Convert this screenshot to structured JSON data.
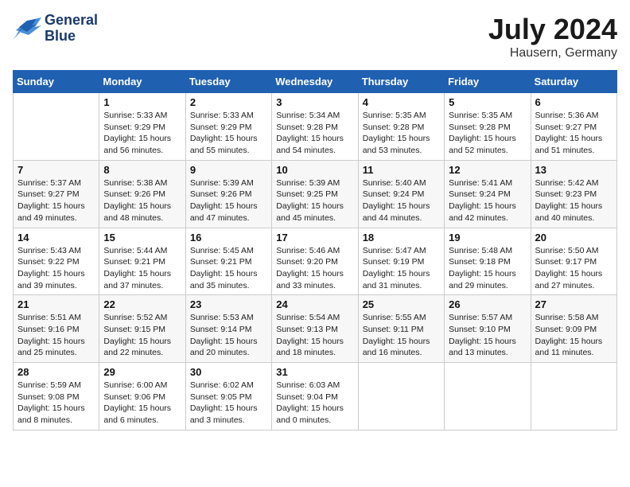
{
  "header": {
    "logo_line1": "General",
    "logo_line2": "Blue",
    "month_year": "July 2024",
    "location": "Hausern, Germany"
  },
  "weekdays": [
    "Sunday",
    "Monday",
    "Tuesday",
    "Wednesday",
    "Thursday",
    "Friday",
    "Saturday"
  ],
  "weeks": [
    [
      {
        "day": "",
        "info": ""
      },
      {
        "day": "1",
        "info": "Sunrise: 5:33 AM\nSunset: 9:29 PM\nDaylight: 15 hours\nand 56 minutes."
      },
      {
        "day": "2",
        "info": "Sunrise: 5:33 AM\nSunset: 9:29 PM\nDaylight: 15 hours\nand 55 minutes."
      },
      {
        "day": "3",
        "info": "Sunrise: 5:34 AM\nSunset: 9:28 PM\nDaylight: 15 hours\nand 54 minutes."
      },
      {
        "day": "4",
        "info": "Sunrise: 5:35 AM\nSunset: 9:28 PM\nDaylight: 15 hours\nand 53 minutes."
      },
      {
        "day": "5",
        "info": "Sunrise: 5:35 AM\nSunset: 9:28 PM\nDaylight: 15 hours\nand 52 minutes."
      },
      {
        "day": "6",
        "info": "Sunrise: 5:36 AM\nSunset: 9:27 PM\nDaylight: 15 hours\nand 51 minutes."
      }
    ],
    [
      {
        "day": "7",
        "info": "Sunrise: 5:37 AM\nSunset: 9:27 PM\nDaylight: 15 hours\nand 49 minutes."
      },
      {
        "day": "8",
        "info": "Sunrise: 5:38 AM\nSunset: 9:26 PM\nDaylight: 15 hours\nand 48 minutes."
      },
      {
        "day": "9",
        "info": "Sunrise: 5:39 AM\nSunset: 9:26 PM\nDaylight: 15 hours\nand 47 minutes."
      },
      {
        "day": "10",
        "info": "Sunrise: 5:39 AM\nSunset: 9:25 PM\nDaylight: 15 hours\nand 45 minutes."
      },
      {
        "day": "11",
        "info": "Sunrise: 5:40 AM\nSunset: 9:24 PM\nDaylight: 15 hours\nand 44 minutes."
      },
      {
        "day": "12",
        "info": "Sunrise: 5:41 AM\nSunset: 9:24 PM\nDaylight: 15 hours\nand 42 minutes."
      },
      {
        "day": "13",
        "info": "Sunrise: 5:42 AM\nSunset: 9:23 PM\nDaylight: 15 hours\nand 40 minutes."
      }
    ],
    [
      {
        "day": "14",
        "info": "Sunrise: 5:43 AM\nSunset: 9:22 PM\nDaylight: 15 hours\nand 39 minutes."
      },
      {
        "day": "15",
        "info": "Sunrise: 5:44 AM\nSunset: 9:21 PM\nDaylight: 15 hours\nand 37 minutes."
      },
      {
        "day": "16",
        "info": "Sunrise: 5:45 AM\nSunset: 9:21 PM\nDaylight: 15 hours\nand 35 minutes."
      },
      {
        "day": "17",
        "info": "Sunrise: 5:46 AM\nSunset: 9:20 PM\nDaylight: 15 hours\nand 33 minutes."
      },
      {
        "day": "18",
        "info": "Sunrise: 5:47 AM\nSunset: 9:19 PM\nDaylight: 15 hours\nand 31 minutes."
      },
      {
        "day": "19",
        "info": "Sunrise: 5:48 AM\nSunset: 9:18 PM\nDaylight: 15 hours\nand 29 minutes."
      },
      {
        "day": "20",
        "info": "Sunrise: 5:50 AM\nSunset: 9:17 PM\nDaylight: 15 hours\nand 27 minutes."
      }
    ],
    [
      {
        "day": "21",
        "info": "Sunrise: 5:51 AM\nSunset: 9:16 PM\nDaylight: 15 hours\nand 25 minutes."
      },
      {
        "day": "22",
        "info": "Sunrise: 5:52 AM\nSunset: 9:15 PM\nDaylight: 15 hours\nand 22 minutes."
      },
      {
        "day": "23",
        "info": "Sunrise: 5:53 AM\nSunset: 9:14 PM\nDaylight: 15 hours\nand 20 minutes."
      },
      {
        "day": "24",
        "info": "Sunrise: 5:54 AM\nSunset: 9:13 PM\nDaylight: 15 hours\nand 18 minutes."
      },
      {
        "day": "25",
        "info": "Sunrise: 5:55 AM\nSunset: 9:11 PM\nDaylight: 15 hours\nand 16 minutes."
      },
      {
        "day": "26",
        "info": "Sunrise: 5:57 AM\nSunset: 9:10 PM\nDaylight: 15 hours\nand 13 minutes."
      },
      {
        "day": "27",
        "info": "Sunrise: 5:58 AM\nSunset: 9:09 PM\nDaylight: 15 hours\nand 11 minutes."
      }
    ],
    [
      {
        "day": "28",
        "info": "Sunrise: 5:59 AM\nSunset: 9:08 PM\nDaylight: 15 hours\nand 8 minutes."
      },
      {
        "day": "29",
        "info": "Sunrise: 6:00 AM\nSunset: 9:06 PM\nDaylight: 15 hours\nand 6 minutes."
      },
      {
        "day": "30",
        "info": "Sunrise: 6:02 AM\nSunset: 9:05 PM\nDaylight: 15 hours\nand 3 minutes."
      },
      {
        "day": "31",
        "info": "Sunrise: 6:03 AM\nSunset: 9:04 PM\nDaylight: 15 hours\nand 0 minutes."
      },
      {
        "day": "",
        "info": ""
      },
      {
        "day": "",
        "info": ""
      },
      {
        "day": "",
        "info": ""
      }
    ]
  ]
}
